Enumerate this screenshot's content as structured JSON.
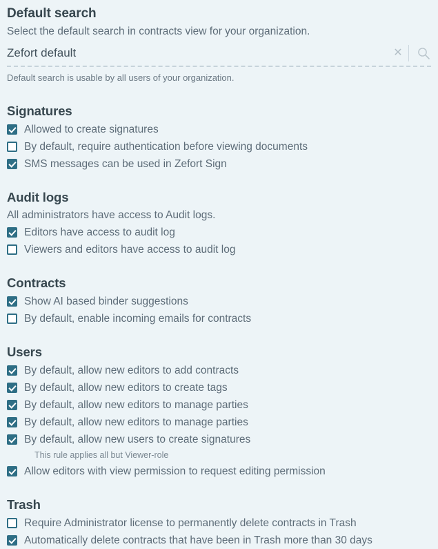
{
  "default_search": {
    "title": "Default search",
    "subtitle": "Select the default search in contracts view for your organization.",
    "field_value": "Zefort default",
    "field_placeholder": "Zefort default",
    "clear_icon": "close-x-icon",
    "search_icon": "search-icon",
    "helper": "Default search is usable by all users of your organization."
  },
  "sections": [
    {
      "heading": "Signatures",
      "note": "",
      "items": [
        {
          "label": "Allowed to create signatures",
          "checked": true
        },
        {
          "label": "By default, require authentication before viewing documents",
          "checked": false
        },
        {
          "label": "SMS messages can be used in Zefort Sign",
          "checked": true
        }
      ]
    },
    {
      "heading": "Audit logs",
      "note": "All administrators have access to Audit logs.",
      "items": [
        {
          "label": "Editors have access to audit log",
          "checked": true
        },
        {
          "label": "Viewers and editors have access to audit log",
          "checked": false
        }
      ]
    },
    {
      "heading": "Contracts",
      "note": "",
      "items": [
        {
          "label": "Show AI based binder suggestions",
          "checked": true
        },
        {
          "label": "By default, enable incoming emails for contracts",
          "checked": false
        }
      ]
    },
    {
      "heading": "Users",
      "note": "",
      "items": [
        {
          "label": "By default, allow new editors to add contracts",
          "checked": true
        },
        {
          "label": "By default, allow new editors to create tags",
          "checked": true
        },
        {
          "label": "By default, allow new editors to manage parties",
          "checked": true
        },
        {
          "label": "By default, allow new editors to manage parties",
          "checked": true
        },
        {
          "label": "By default, allow new users to create signatures",
          "checked": true,
          "sub_note": "This rule applies all but Viewer-role"
        },
        {
          "label": "Allow editors with view permission to request editing permission",
          "checked": true
        }
      ]
    },
    {
      "heading": "Trash",
      "note": "",
      "items": [
        {
          "label": "Require Administrator license to permanently delete contracts in Trash",
          "checked": false
        },
        {
          "label": "Automatically delete contracts that have been in Trash more than 30 days",
          "checked": true
        }
      ]
    }
  ],
  "colors": {
    "background": "#edf4f7",
    "heading": "#37474f",
    "body_text": "#5d6c78",
    "accent": "#2e6e85",
    "muted": "#b3bfc7"
  }
}
